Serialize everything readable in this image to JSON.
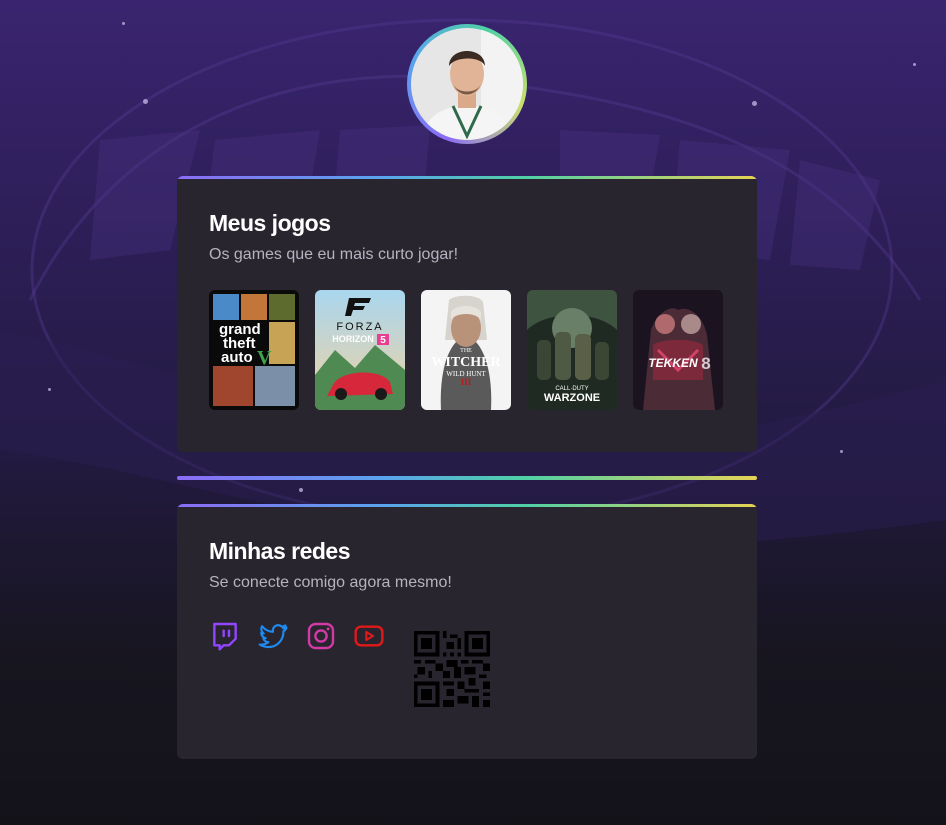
{
  "profile": {
    "avatar_alt": "Foto de perfil"
  },
  "games_section": {
    "title": "Meus jogos",
    "subtitle": "Os games que eu mais curto jogar!",
    "games": [
      {
        "name": "grand theft auto V",
        "lines": [
          "grand",
          "theft",
          "auto",
          "V"
        ]
      },
      {
        "name": "FORZA HORIZON 5",
        "lines": [
          "FORZA",
          "HORIZON",
          "5"
        ]
      },
      {
        "name": "THE WITCHER WILD HUNT",
        "lines": [
          "THE",
          "WITCHER",
          "WILD HUNT",
          "III"
        ]
      },
      {
        "name": "CALL OF DUTY WARZONE",
        "lines": [
          "CALL·DUTY",
          "WARZONE"
        ]
      },
      {
        "name": "TEKKEN 8",
        "lines": [
          "TEKKEN",
          "8"
        ]
      }
    ]
  },
  "socials_section": {
    "title": "Minhas redes",
    "subtitle": "Se conecte comigo agora mesmo!",
    "links": [
      {
        "name": "twitch",
        "color": "#9146ff"
      },
      {
        "name": "twitter",
        "color": "#1d8bf0"
      },
      {
        "name": "instagram",
        "color": "#e1306c"
      },
      {
        "name": "youtube",
        "color": "#e01919"
      }
    ]
  },
  "colors": {
    "accent_gradient": [
      "#8b6cf6",
      "#5aa3ef",
      "#4fd1a5",
      "#e6d356"
    ],
    "card_bg": "#29252f",
    "page_bg_top": "#3a2470",
    "page_bg_bottom": "#141219"
  }
}
